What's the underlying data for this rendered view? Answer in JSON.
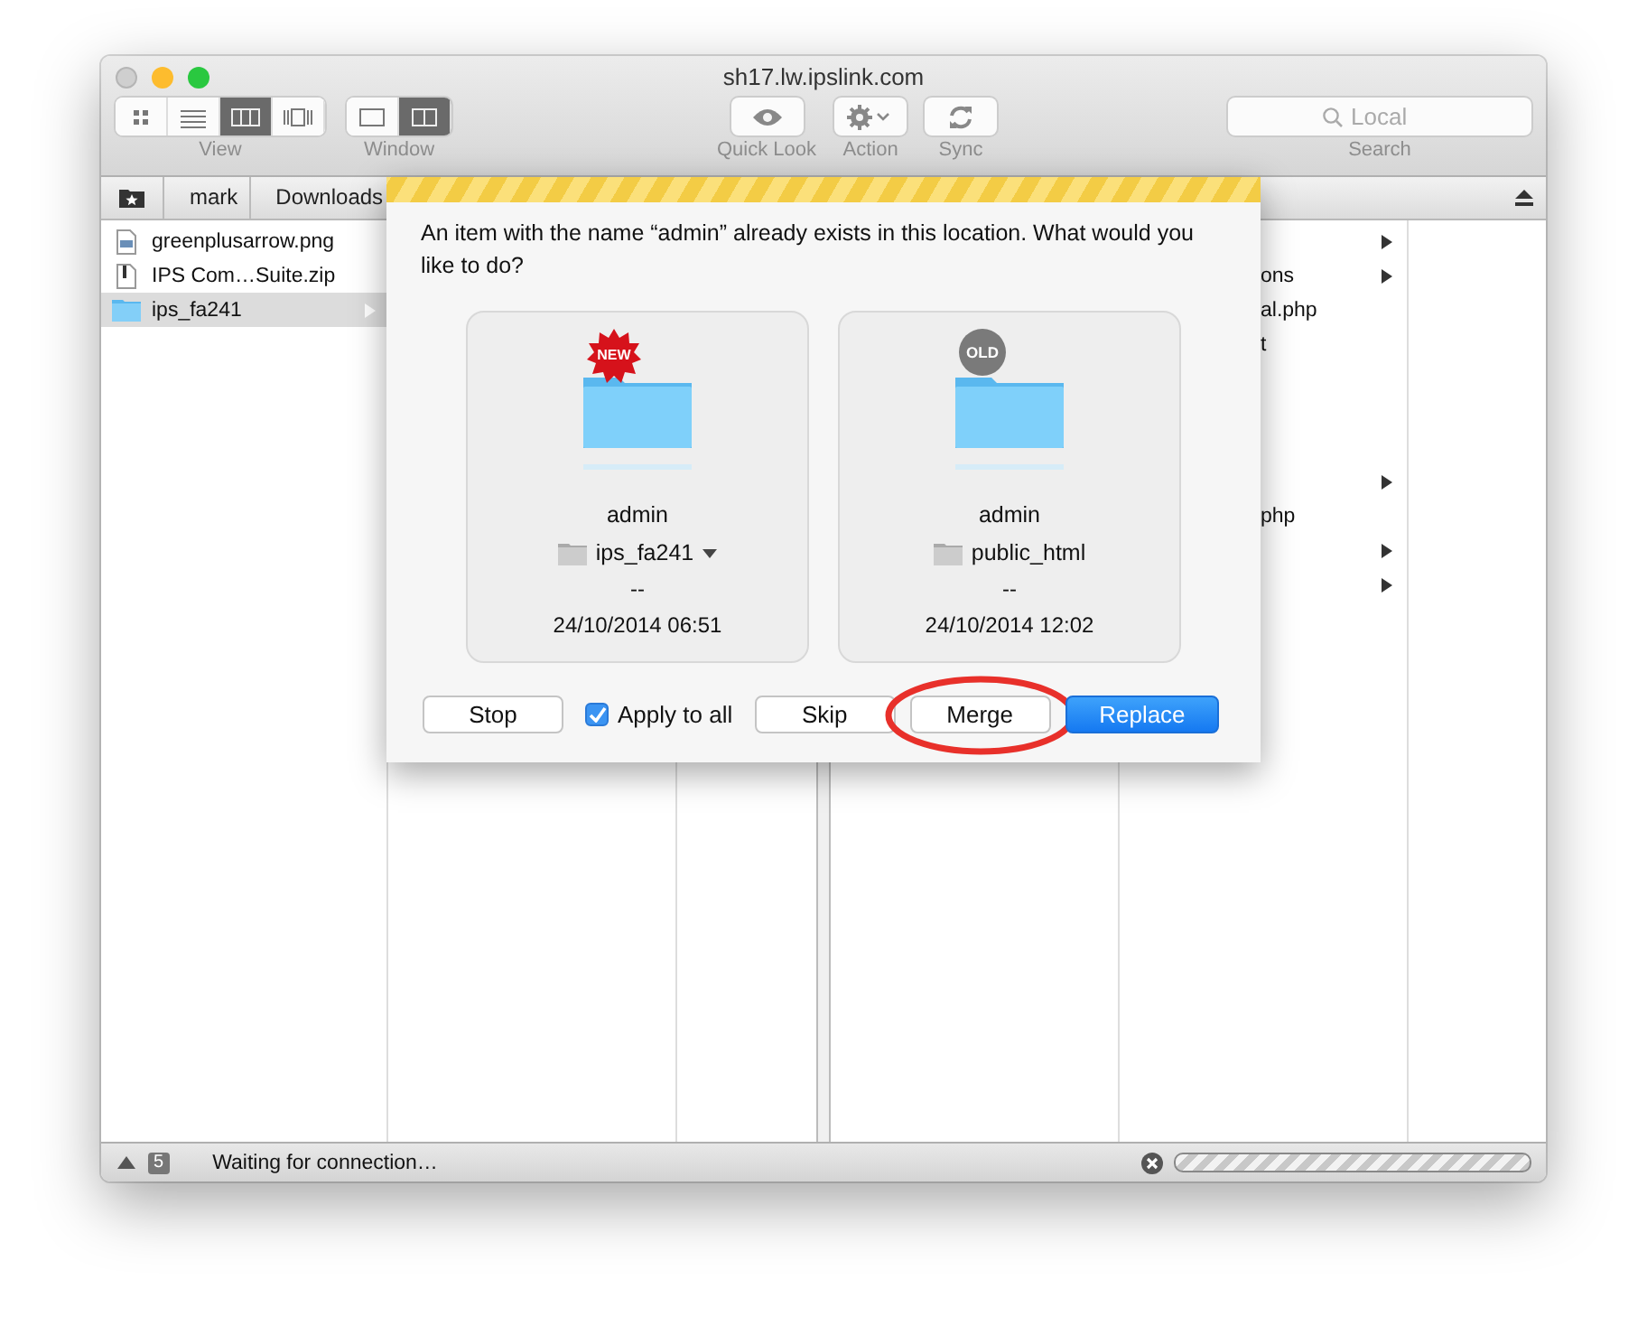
{
  "window": {
    "title": "sh17.lw.ipslink.com"
  },
  "toolbar": {
    "view_modes": [
      {
        "selected": false
      },
      {
        "selected": false
      },
      {
        "selected": true
      },
      {
        "selected": false
      }
    ],
    "view_label": "View",
    "window_modes": [
      {
        "selected": false
      },
      {
        "selected": true
      }
    ],
    "window_label": "Window",
    "actions": [
      {
        "label": "Quick Look"
      },
      {
        "label": "Action"
      },
      {
        "label": "Sync"
      }
    ],
    "search": {
      "placeholder": "Local",
      "label": "Search"
    }
  },
  "path_bar": {
    "crumbs": [
      "mark",
      "Downloads"
    ]
  },
  "left_pane": {
    "files": [
      {
        "name": "greenplusarrow.png",
        "kind": "image",
        "selected": false,
        "has_children": false
      },
      {
        "name": "IPS Com…Suite.zip",
        "kind": "zip",
        "selected": false,
        "has_children": false
      },
      {
        "name": "ips_fa241",
        "kind": "folder",
        "selected": true,
        "has_children": true
      }
    ]
  },
  "right_pane": {
    "rows": [
      {
        "has_children": true
      },
      {
        "text": "ons",
        "has_children": true
      },
      {
        "text": "al.php",
        "has_children": false
      },
      {
        "text": "t",
        "has_children": false
      },
      {
        "has_children": false
      },
      {
        "has_children": false
      },
      {
        "has_children": false
      },
      {
        "has_children": true
      },
      {
        "text": "php",
        "has_children": false
      },
      {
        "has_children": true
      },
      {
        "has_children": true
      }
    ]
  },
  "dialog": {
    "message": "An item with the name “admin” already exists in this location. What would you like to do?",
    "items": [
      {
        "badge": "NEW",
        "kind": "new",
        "name": "admin",
        "location": "ips_fa241",
        "has_menu": true,
        "size": "--",
        "date": "24/10/2014 06:51"
      },
      {
        "badge": "OLD",
        "kind": "old",
        "name": "admin",
        "location": "public_html",
        "has_menu": false,
        "size": "--",
        "date": "24/10/2014 12:02"
      }
    ],
    "buttons": [
      {
        "label": "Stop",
        "kind": "button",
        "default": false,
        "highlighted": false
      },
      {
        "label": "Apply to all",
        "kind": "checkbox",
        "checked": true
      },
      {
        "label": "Skip",
        "kind": "button",
        "default": false,
        "highlighted": false
      },
      {
        "label": "Merge",
        "kind": "button",
        "default": false,
        "highlighted": true
      },
      {
        "label": "Replace",
        "kind": "button",
        "default": true,
        "highlighted": false
      }
    ]
  },
  "status_bar": {
    "count": "5",
    "message": "Waiting for connection…",
    "indeterminate": true
  }
}
